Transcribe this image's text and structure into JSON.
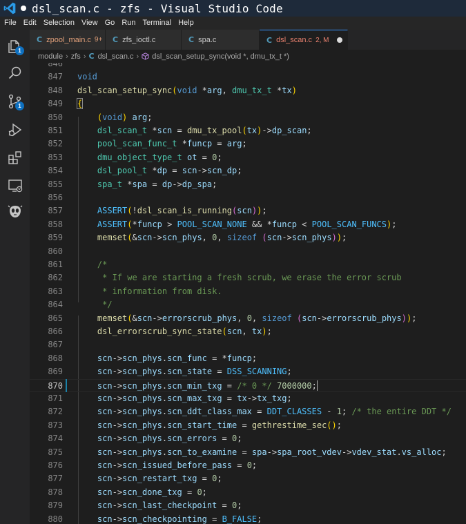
{
  "window": {
    "title": "dsl_scan.c - zfs - Visual Studio Code"
  },
  "menu": [
    "File",
    "Edit",
    "Selection",
    "View",
    "Go",
    "Run",
    "Terminal",
    "Help"
  ],
  "activity": {
    "explorer_badge": "1",
    "scm_badge": "1"
  },
  "tabs": [
    {
      "icon": "C",
      "label": "zpool_main.c",
      "badge": "9+",
      "modified": true,
      "active": false
    },
    {
      "icon": "C",
      "label": "zfs_ioctl.c",
      "badge": "",
      "modified": false,
      "active": false
    },
    {
      "icon": "C",
      "label": "spa.c",
      "badge": "",
      "modified": false,
      "active": false
    },
    {
      "icon": "C",
      "label": "dsl_scan.c",
      "badge": "2, M",
      "modified": true,
      "active": true,
      "dirty": true
    }
  ],
  "breadcrumb": [
    "module",
    "zfs",
    "dsl_scan.c",
    "dsl_scan_setup_sync(void *, dmu_tx_t *)"
  ],
  "editor": {
    "current_line": "870",
    "lines": [
      {
        "n": "846",
        "text": ""
      },
      {
        "n": "847",
        "text": "void"
      },
      {
        "n": "848",
        "text": "dsl_scan_setup_sync(void *arg, dmu_tx_t *tx)"
      },
      {
        "n": "849",
        "text": "{"
      },
      {
        "n": "850",
        "text": "    (void) arg;"
      },
      {
        "n": "851",
        "text": "    dsl_scan_t *scn = dmu_tx_pool(tx)->dp_scan;"
      },
      {
        "n": "852",
        "text": "    pool_scan_func_t *funcp = arg;"
      },
      {
        "n": "853",
        "text": "    dmu_object_type_t ot = 0;"
      },
      {
        "n": "854",
        "text": "    dsl_pool_t *dp = scn->scn_dp;"
      },
      {
        "n": "855",
        "text": "    spa_t *spa = dp->dp_spa;"
      },
      {
        "n": "856",
        "text": ""
      },
      {
        "n": "857",
        "text": "    ASSERT(!dsl_scan_is_running(scn));"
      },
      {
        "n": "858",
        "text": "    ASSERT(*funcp > POOL_SCAN_NONE && *funcp < POOL_SCAN_FUNCS);"
      },
      {
        "n": "859",
        "text": "    memset(&scn->scn_phys, 0, sizeof (scn->scn_phys));"
      },
      {
        "n": "860",
        "text": ""
      },
      {
        "n": "861",
        "text": "    /*"
      },
      {
        "n": "862",
        "text": "     * If we are starting a fresh scrub, we erase the error scrub"
      },
      {
        "n": "863",
        "text": "     * information from disk."
      },
      {
        "n": "864",
        "text": "     */"
      },
      {
        "n": "865",
        "text": "    memset(&scn->errorscrub_phys, 0, sizeof (scn->errorscrub_phys));"
      },
      {
        "n": "866",
        "text": "    dsl_errorscrub_sync_state(scn, tx);"
      },
      {
        "n": "867",
        "text": ""
      },
      {
        "n": "868",
        "text": "    scn->scn_phys.scn_func = *funcp;"
      },
      {
        "n": "869",
        "text": "    scn->scn_phys.scn_state = DSS_SCANNING;"
      },
      {
        "n": "870",
        "text": "    scn->scn_phys.scn_min_txg = /* 0 */ 7000000;"
      },
      {
        "n": "871",
        "text": "    scn->scn_phys.scn_max_txg = tx->tx_txg;"
      },
      {
        "n": "872",
        "text": "    scn->scn_phys.scn_ddt_class_max = DDT_CLASSES - 1; /* the entire DDT */"
      },
      {
        "n": "873",
        "text": "    scn->scn_phys.scn_start_time = gethrestime_sec();"
      },
      {
        "n": "874",
        "text": "    scn->scn_phys.scn_errors = 0;"
      },
      {
        "n": "875",
        "text": "    scn->scn_phys.scn_to_examine = spa->spa_root_vdev->vdev_stat.vs_alloc;"
      },
      {
        "n": "876",
        "text": "    scn->scn_issued_before_pass = 0;"
      },
      {
        "n": "877",
        "text": "    scn->scn_restart_txg = 0;"
      },
      {
        "n": "878",
        "text": "    scn->scn_done_txg = 0;"
      },
      {
        "n": "879",
        "text": "    scn->scn_last_checkpoint = 0;"
      },
      {
        "n": "880",
        "text": "    scn->scn_checkpointing = B_FALSE;"
      }
    ]
  },
  "colors": {
    "keyword": "#569cd6",
    "type": "#4ec9b0",
    "function": "#dcdcaa",
    "variable": "#9cdcfe",
    "number": "#b5cea8",
    "comment": "#6a9955",
    "macro": "#4fc1ff",
    "accent": "#3794ff",
    "badge": "#0e70c0",
    "modified_tab": "#e2a07a"
  }
}
